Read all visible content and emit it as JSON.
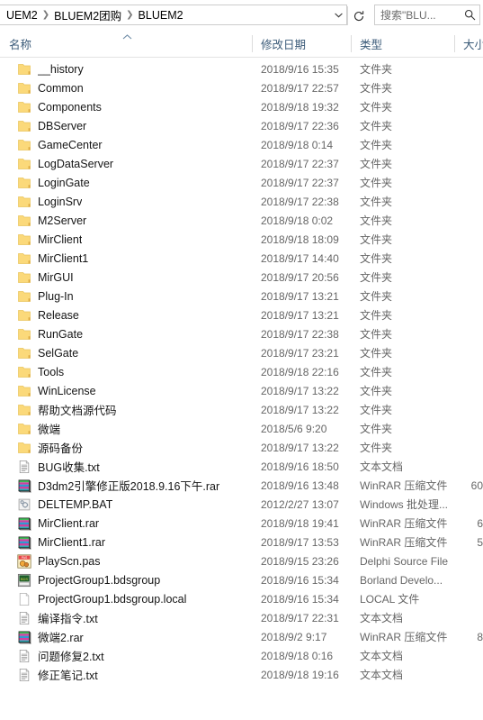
{
  "address": {
    "breadcrumbs": [
      "UEM2",
      "BLUEM2团购",
      "BLUEM2"
    ],
    "separator": "❯",
    "dropdown_icon": "chevron-down-icon",
    "refresh_icon": "refresh-icon"
  },
  "search": {
    "value": "搜索\"BLU...",
    "icon": "search-icon"
  },
  "columns": {
    "name": "名称",
    "date": "修改日期",
    "type": "类型",
    "size": "大小",
    "sort_caret": "︿"
  },
  "types": {
    "folder": "文件夹",
    "text": "文本文档",
    "winrar": "WinRAR 压缩文件",
    "bat": "Windows 批处理...",
    "delphi": "Delphi Source File",
    "borland": "Borland Develo...",
    "local": "LOCAL 文件"
  },
  "files": [
    {
      "name": "__history",
      "icon": "folder-icon",
      "date": "2018/9/16 15:35",
      "type": "文件夹",
      "size": ""
    },
    {
      "name": "Common",
      "icon": "folder-icon",
      "date": "2018/9/17 22:57",
      "type": "文件夹",
      "size": ""
    },
    {
      "name": "Components",
      "icon": "folder-icon",
      "date": "2018/9/18 19:32",
      "type": "文件夹",
      "size": ""
    },
    {
      "name": "DBServer",
      "icon": "folder-icon",
      "date": "2018/9/17 22:36",
      "type": "文件夹",
      "size": ""
    },
    {
      "name": "GameCenter",
      "icon": "folder-icon",
      "date": "2018/9/18 0:14",
      "type": "文件夹",
      "size": ""
    },
    {
      "name": "LogDataServer",
      "icon": "folder-icon",
      "date": "2018/9/17 22:37",
      "type": "文件夹",
      "size": ""
    },
    {
      "name": "LoginGate",
      "icon": "folder-icon",
      "date": "2018/9/17 22:37",
      "type": "文件夹",
      "size": ""
    },
    {
      "name": "LoginSrv",
      "icon": "folder-icon",
      "date": "2018/9/17 22:38",
      "type": "文件夹",
      "size": ""
    },
    {
      "name": "M2Server",
      "icon": "folder-icon",
      "date": "2018/9/18 0:02",
      "type": "文件夹",
      "size": ""
    },
    {
      "name": "MirClient",
      "icon": "folder-icon",
      "date": "2018/9/18 18:09",
      "type": "文件夹",
      "size": ""
    },
    {
      "name": "MirClient1",
      "icon": "folder-icon",
      "date": "2018/9/17 14:40",
      "type": "文件夹",
      "size": ""
    },
    {
      "name": "MirGUI",
      "icon": "folder-icon",
      "date": "2018/9/17 20:56",
      "type": "文件夹",
      "size": ""
    },
    {
      "name": "Plug-In",
      "icon": "folder-icon",
      "date": "2018/9/17 13:21",
      "type": "文件夹",
      "size": ""
    },
    {
      "name": "Release",
      "icon": "folder-icon",
      "date": "2018/9/17 13:21",
      "type": "文件夹",
      "size": ""
    },
    {
      "name": "RunGate",
      "icon": "folder-icon",
      "date": "2018/9/17 22:38",
      "type": "文件夹",
      "size": ""
    },
    {
      "name": "SelGate",
      "icon": "folder-icon",
      "date": "2018/9/17 23:21",
      "type": "文件夹",
      "size": ""
    },
    {
      "name": "Tools",
      "icon": "folder-icon",
      "date": "2018/9/18 22:16",
      "type": "文件夹",
      "size": ""
    },
    {
      "name": "WinLicense",
      "icon": "folder-icon",
      "date": "2018/9/17 13:22",
      "type": "文件夹",
      "size": ""
    },
    {
      "name": "帮助文档源代码",
      "icon": "folder-icon",
      "date": "2018/9/17 13:22",
      "type": "文件夹",
      "size": ""
    },
    {
      "name": "微端",
      "icon": "folder-icon",
      "date": "2018/5/6 9:20",
      "type": "文件夹",
      "size": ""
    },
    {
      "name": "源码备份",
      "icon": "folder-icon",
      "date": "2018/9/17 13:22",
      "type": "文件夹",
      "size": ""
    },
    {
      "name": "BUG收集.txt",
      "icon": "text-file-icon",
      "date": "2018/9/16 18:50",
      "type": "文本文档",
      "size": ""
    },
    {
      "name": "D3dm2引擎修正版2018.9.16下午.rar",
      "icon": "winrar-icon",
      "date": "2018/9/16 13:48",
      "type": "WinRAR 压缩文件",
      "size": "60"
    },
    {
      "name": "DELTEMP.BAT",
      "icon": "bat-file-icon",
      "date": "2012/2/27 13:07",
      "type": "Windows 批处理...",
      "size": ""
    },
    {
      "name": "MirClient.rar",
      "icon": "winrar-icon",
      "date": "2018/9/18 19:41",
      "type": "WinRAR 压缩文件",
      "size": "6"
    },
    {
      "name": "MirClient1.rar",
      "icon": "winrar-icon",
      "date": "2018/9/17 13:53",
      "type": "WinRAR 压缩文件",
      "size": "5"
    },
    {
      "name": "PlayScn.pas",
      "icon": "delphi-pas-icon",
      "date": "2018/9/15 23:26",
      "type": "Delphi Source File",
      "size": ""
    },
    {
      "name": "ProjectGroup1.bdsgroup",
      "icon": "bds-file-icon",
      "date": "2018/9/16 15:34",
      "type": "Borland Develo...",
      "size": ""
    },
    {
      "name": "ProjectGroup1.bdsgroup.local",
      "icon": "blank-file-icon",
      "date": "2018/9/16 15:34",
      "type": "LOCAL 文件",
      "size": ""
    },
    {
      "name": "编译指令.txt",
      "icon": "text-file-icon",
      "date": "2018/9/17 22:31",
      "type": "文本文档",
      "size": ""
    },
    {
      "name": "微端2.rar",
      "icon": "winrar-icon",
      "date": "2018/9/2 9:17",
      "type": "WinRAR 压缩文件",
      "size": "8"
    },
    {
      "name": "问题修复2.txt",
      "icon": "text-file-icon",
      "date": "2018/9/18 0:16",
      "type": "文本文档",
      "size": ""
    },
    {
      "name": "修正笔记.txt",
      "icon": "text-file-icon",
      "date": "2018/9/18 19:16",
      "type": "文本文档",
      "size": ""
    }
  ]
}
